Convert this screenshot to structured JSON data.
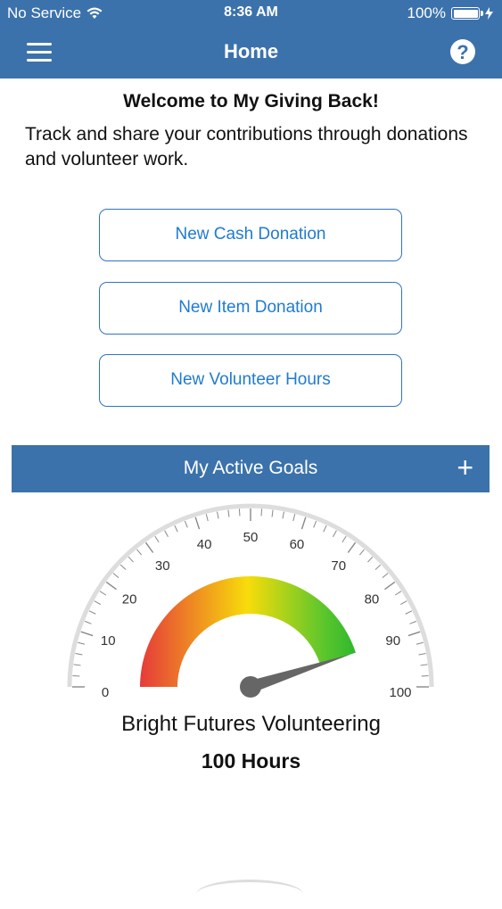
{
  "status_bar": {
    "carrier": "No Service",
    "time": "8:36 AM",
    "battery_percent": "100%"
  },
  "nav": {
    "title": "Home",
    "menu_icon": "hamburger-menu-icon",
    "help_icon": "help-question-icon",
    "help_glyph": "?"
  },
  "welcome": {
    "title": "Welcome to My Giving Back!",
    "text": "Track and share your contributions through donations and volunteer work."
  },
  "actions": {
    "cash": "New Cash Donation",
    "item": "New Item Donation",
    "hours": "New Volunteer Hours"
  },
  "goals": {
    "header": "My Active Goals",
    "add_glyph": "+"
  },
  "gauge": {
    "min": 0,
    "max": 100,
    "tick_labels": [
      "0",
      "10",
      "20",
      "30",
      "40",
      "50",
      "60",
      "70",
      "80",
      "90",
      "100"
    ],
    "needle_value": 90,
    "colors": {
      "scale_arc": "#dddddd",
      "band_low": "#e63a3a",
      "band_mid": "#f7dd0a",
      "band_high": "#2eb82e",
      "needle": "#666666"
    },
    "goal_name": "Bright Futures Volunteering",
    "goal_amount": "100 Hours"
  },
  "colors": {
    "brand": "#3b72ac",
    "button_text": "#1f7bd0"
  }
}
